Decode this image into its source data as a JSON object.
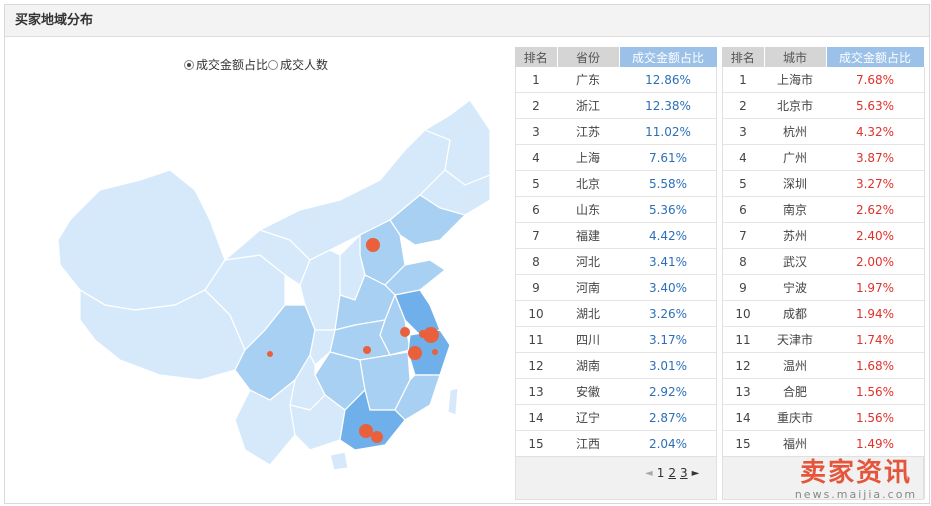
{
  "panel": {
    "title": "买家地域分布"
  },
  "toggle": {
    "option_amount": "成交金额占比",
    "option_people": "成交人数",
    "selected": "成交金额占比"
  },
  "colors": {
    "header_highlight": "#9bc1e8",
    "province_value": "#2c6fb7",
    "city_value": "#e0312b",
    "map_light": "#d6e9fa",
    "map_medium": "#a8d0f3",
    "map_dark": "#6fb0ea",
    "marker": "#e8603c"
  },
  "province_table": {
    "headers": [
      "排名",
      "省份",
      "成交金额占比"
    ],
    "rows": [
      [
        "1",
        "广东",
        "12.86%"
      ],
      [
        "2",
        "浙江",
        "12.38%"
      ],
      [
        "3",
        "江苏",
        "11.02%"
      ],
      [
        "4",
        "上海",
        "7.61%"
      ],
      [
        "5",
        "北京",
        "5.58%"
      ],
      [
        "6",
        "山东",
        "5.36%"
      ],
      [
        "7",
        "福建",
        "4.42%"
      ],
      [
        "8",
        "河北",
        "3.41%"
      ],
      [
        "9",
        "河南",
        "3.40%"
      ],
      [
        "10",
        "湖北",
        "3.26%"
      ],
      [
        "11",
        "四川",
        "3.17%"
      ],
      [
        "12",
        "湖南",
        "3.01%"
      ],
      [
        "13",
        "安徽",
        "2.92%"
      ],
      [
        "14",
        "辽宁",
        "2.87%"
      ],
      [
        "15",
        "江西",
        "2.04%"
      ]
    ]
  },
  "city_table": {
    "headers": [
      "排名",
      "城市",
      "成交金额占比"
    ],
    "rows": [
      [
        "1",
        "上海市",
        "7.68%"
      ],
      [
        "2",
        "北京市",
        "5.63%"
      ],
      [
        "3",
        "杭州",
        "4.32%"
      ],
      [
        "4",
        "广州",
        "3.87%"
      ],
      [
        "5",
        "深圳",
        "3.27%"
      ],
      [
        "6",
        "南京",
        "2.62%"
      ],
      [
        "7",
        "苏州",
        "2.40%"
      ],
      [
        "8",
        "武汉",
        "2.00%"
      ],
      [
        "9",
        "宁波",
        "1.97%"
      ],
      [
        "10",
        "成都",
        "1.94%"
      ],
      [
        "11",
        "天津市",
        "1.74%"
      ],
      [
        "12",
        "温州",
        "1.68%"
      ],
      [
        "13",
        "合肥",
        "1.56%"
      ],
      [
        "14",
        "重庆市",
        "1.56%"
      ],
      [
        "15",
        "福州",
        "1.49%"
      ]
    ]
  },
  "pager": {
    "prev": "◄",
    "pages": [
      "1",
      "2",
      "3"
    ],
    "next": "►"
  },
  "watermark": {
    "title": "卖家资讯",
    "subtitle": "news.maijia.com"
  }
}
